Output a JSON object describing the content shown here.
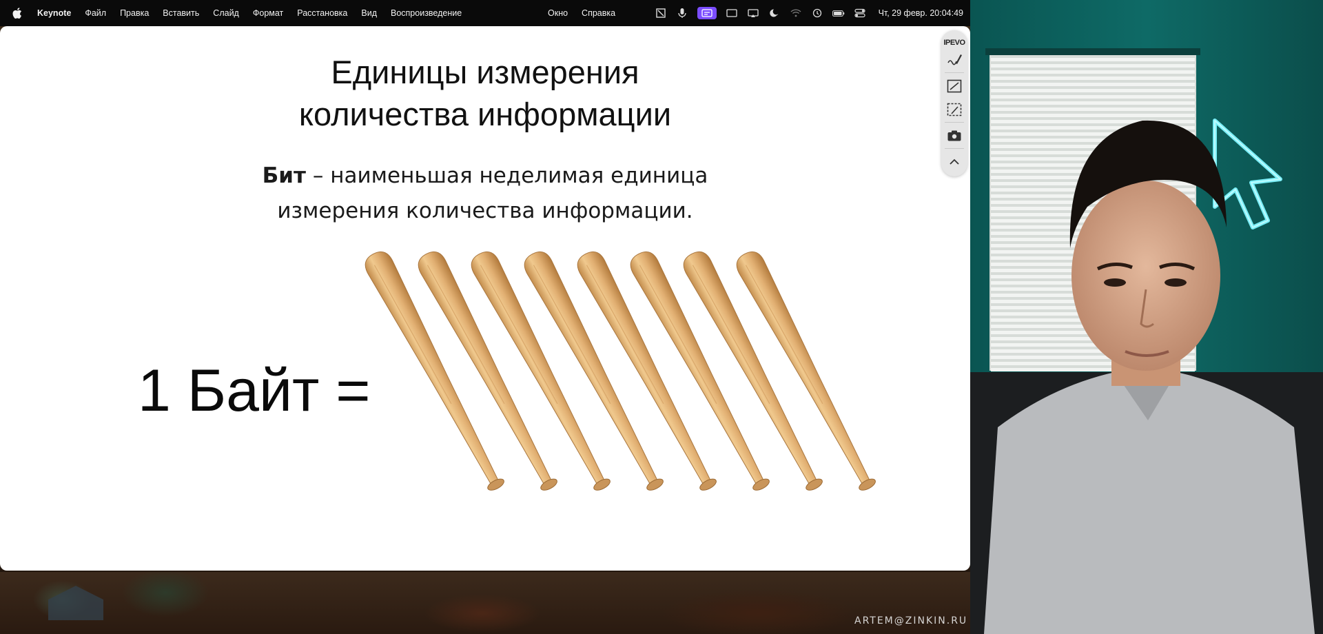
{
  "menubar": {
    "app_name": "Keynote",
    "menus": [
      "Файл",
      "Правка",
      "Вставить",
      "Слайд",
      "Формат",
      "Расстановка",
      "Вид",
      "Воспроизведение"
    ],
    "menus_right": [
      "Окно",
      "Справка"
    ],
    "clock": "Чт, 29 февр.  20:04:49",
    "accent_color": "#7b4dff"
  },
  "slide": {
    "title_line1": "Единицы измерения",
    "title_line2": "количества информации",
    "definition_term": "Бит",
    "definition_rest": " – наименьшая неделимая единица",
    "definition_line2": "измерения количества информации.",
    "equation": "1 Байт =",
    "bat_count": 8
  },
  "toolbar": {
    "logo": "IPEVO",
    "buttons": [
      "annotate-icon",
      "whiteboard-icon",
      "transparent-board-icon",
      "camera-icon",
      "chevron-up-icon"
    ]
  },
  "watermark": "ARTEM@ZINKIN.RU"
}
